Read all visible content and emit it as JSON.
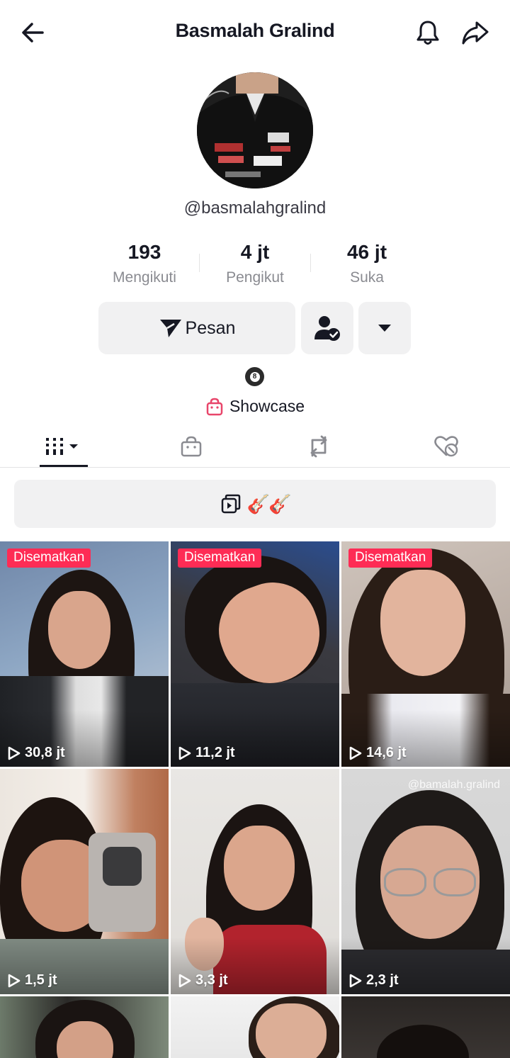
{
  "header": {
    "title": "Basmalah Gralind",
    "back_icon": "arrow-left-icon",
    "bell_icon": "bell-icon",
    "share_icon": "share-icon"
  },
  "profile": {
    "username": "@basmalahgralind",
    "stats": [
      {
        "value": "193",
        "label": "Mengikuti"
      },
      {
        "value": "4 jt",
        "label": "Pengikut"
      },
      {
        "value": "46 jt",
        "label": "Suka"
      }
    ],
    "message_button": "Pesan",
    "badge": "8",
    "showcase": "Showcase"
  },
  "tabs": [
    {
      "icon": "grid-icon",
      "active": true
    },
    {
      "icon": "shopping-bag-icon",
      "active": false
    },
    {
      "icon": "repost-icon",
      "active": false
    },
    {
      "icon": "hidden-likes-icon",
      "active": false
    }
  ],
  "playlist": {
    "label": "🎸🎸"
  },
  "videos": [
    {
      "pinned": "Disematkan",
      "views": "30,8 jt"
    },
    {
      "pinned": "Disematkan",
      "views": "11,2 jt"
    },
    {
      "pinned": "Disematkan",
      "views": "14,6 jt"
    },
    {
      "pinned": "",
      "views": "1,5 jt"
    },
    {
      "pinned": "",
      "views": "3,3 jt"
    },
    {
      "pinned": "",
      "views": "2,3 jt",
      "watermark": "@bamalah.gralind"
    }
  ],
  "colors": {
    "accent": "#fe2c55",
    "text": "#161823",
    "muted": "#8a8b91",
    "button_bg": "#f1f1f2"
  }
}
